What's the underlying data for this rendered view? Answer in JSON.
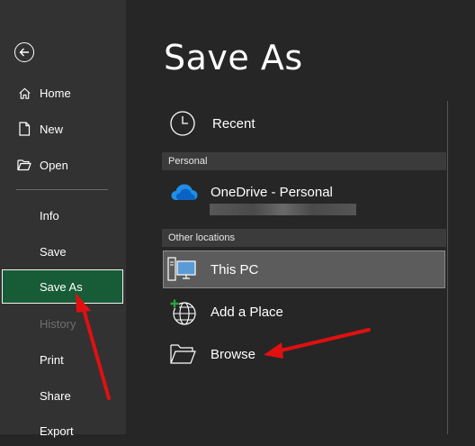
{
  "window": {
    "title": "Save As"
  },
  "sidebar": {
    "items": [
      {
        "label": "Home",
        "icon": "home-icon"
      },
      {
        "label": "New",
        "icon": "new-document-icon"
      },
      {
        "label": "Open",
        "icon": "open-folder-icon"
      },
      {
        "label": "Info"
      },
      {
        "label": "Save"
      },
      {
        "label": "Save As",
        "selected": true
      },
      {
        "label": "History",
        "disabled": true
      },
      {
        "label": "Print"
      },
      {
        "label": "Share"
      },
      {
        "label": "Export"
      }
    ]
  },
  "locations": {
    "recent": "Recent",
    "personal_header": "Personal",
    "onedrive": "OneDrive - Personal",
    "other_header": "Other locations",
    "this_pc": "This PC",
    "add_place": "Add a Place",
    "browse": "Browse"
  },
  "colors": {
    "sidebar_bg": "#323232",
    "main_bg": "#262626",
    "selected_bg": "#185c37",
    "annotation_arrow": "#e01010"
  }
}
